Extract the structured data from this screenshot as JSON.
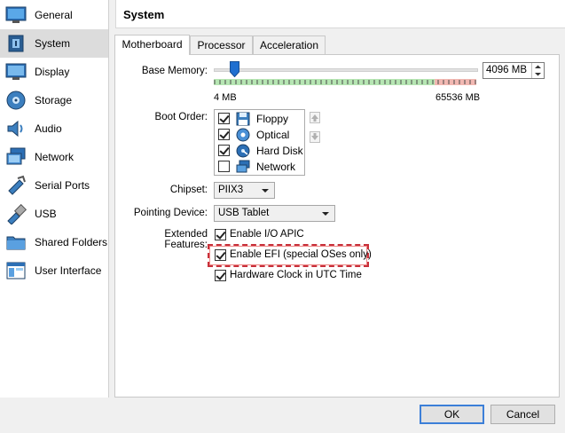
{
  "sidebar": {
    "items": [
      {
        "label": "General",
        "icon": "monitor-general-icon"
      },
      {
        "label": "System",
        "icon": "system-chip-icon"
      },
      {
        "label": "Display",
        "icon": "display-icon"
      },
      {
        "label": "Storage",
        "icon": "storage-disk-icon"
      },
      {
        "label": "Audio",
        "icon": "audio-speaker-icon"
      },
      {
        "label": "Network",
        "icon": "network-icon"
      },
      {
        "label": "Serial Ports",
        "icon": "serial-port-icon"
      },
      {
        "label": "USB",
        "icon": "usb-icon"
      },
      {
        "label": "Shared Folders",
        "icon": "shared-folder-icon"
      },
      {
        "label": "User Interface",
        "icon": "user-interface-icon"
      }
    ],
    "selected": "System"
  },
  "header": {
    "title": "System"
  },
  "tabs": [
    {
      "label": "Motherboard",
      "active": true
    },
    {
      "label": "Processor",
      "active": false
    },
    {
      "label": "Acceleration",
      "active": false
    }
  ],
  "motherboard": {
    "base_memory_label": "Base Memory:",
    "base_memory_value": "4096 MB",
    "base_memory_fraction": 0.0625,
    "memory_min": "4 MB",
    "memory_max": "65536 MB",
    "boot_order_label": "Boot Order:",
    "boot_items": [
      {
        "label": "Floppy",
        "checked": true,
        "icon": "floppy-icon"
      },
      {
        "label": "Optical",
        "checked": true,
        "icon": "optical-disc-icon"
      },
      {
        "label": "Hard Disk",
        "checked": true,
        "icon": "hard-disk-icon"
      },
      {
        "label": "Network",
        "checked": false,
        "icon": "network-boot-icon"
      }
    ],
    "chipset_label": "Chipset:",
    "chipset_value": "PIIX3",
    "pointing_label": "Pointing Device:",
    "pointing_value": "USB Tablet",
    "extended_label": "Extended Features:",
    "features": [
      {
        "label": "Enable I/O APIC",
        "checked": true
      },
      {
        "label": "Enable EFI (special OSes only)",
        "checked": true
      },
      {
        "label": "Hardware Clock in UTC Time",
        "checked": true
      }
    ]
  },
  "buttons": {
    "ok": "OK",
    "cancel": "Cancel"
  },
  "colors": {
    "highlight": "#c8303a",
    "slider_thumb": "#1f6fd0",
    "green_zone": "#b6e6b3",
    "red_zone": "#f2b8b2"
  }
}
